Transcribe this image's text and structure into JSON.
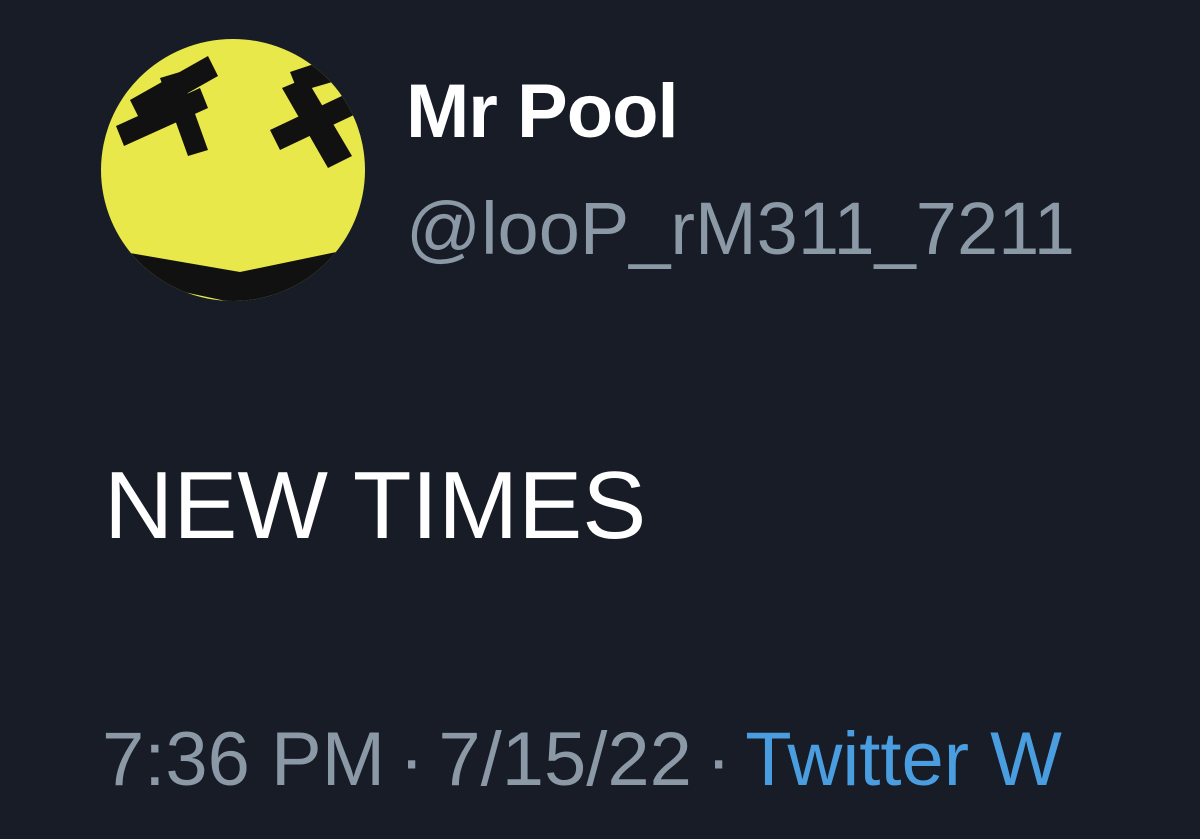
{
  "tweet": {
    "display_name": "Mr Pool",
    "handle": "@looP_rM311_7211",
    "text": "NEW TIMES",
    "time": "7:36 PM",
    "date": "7/15/22",
    "separator": "·",
    "source": "Twitter W"
  },
  "avatar": {
    "icon": "dead-smiley-icon",
    "face_color": "#e8e84a",
    "mark_color": "#111111"
  },
  "colors": {
    "background": "#171c27",
    "primary_text": "#ffffff",
    "secondary_text": "#8b98a5",
    "link": "#4a9ee0"
  }
}
